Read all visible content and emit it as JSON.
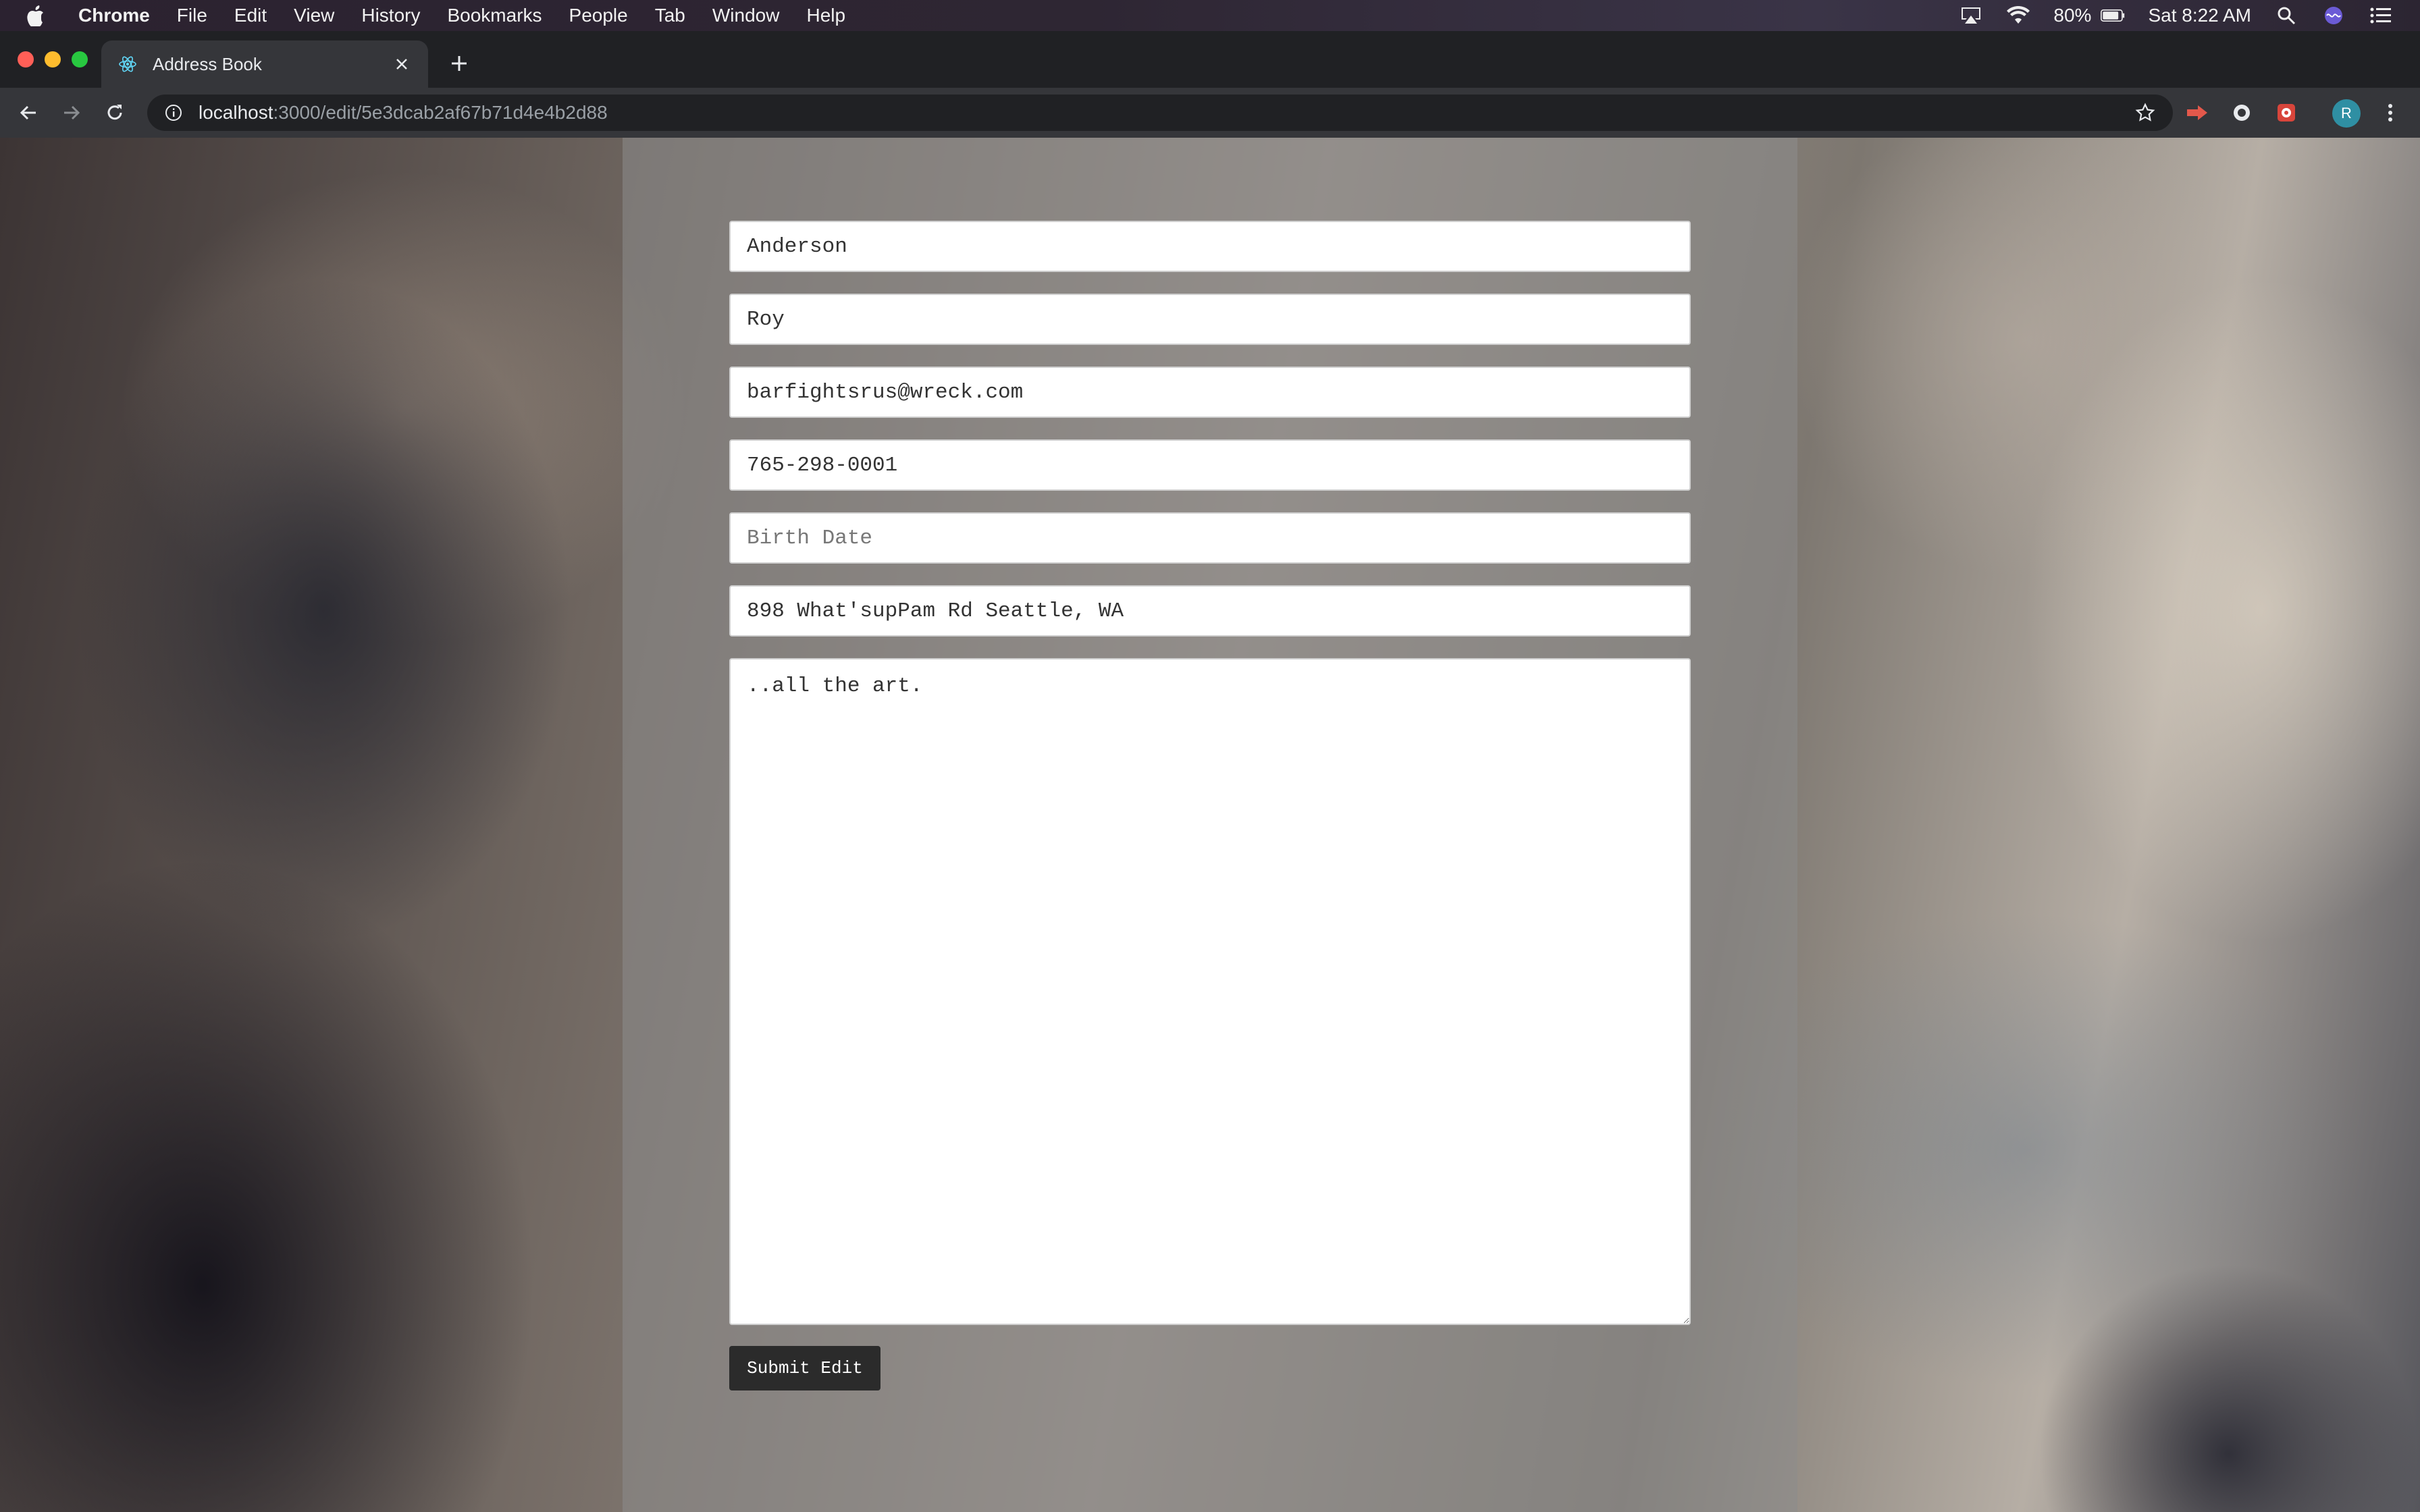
{
  "menubar": {
    "app_name": "Chrome",
    "items": [
      "File",
      "Edit",
      "View",
      "History",
      "Bookmarks",
      "People",
      "Tab",
      "Window",
      "Help"
    ],
    "battery": "80%",
    "clock": "Sat 8:22 AM"
  },
  "browser": {
    "tab_title": "Address Book",
    "url_host": "localhost",
    "url_path": ":3000/edit/5e3dcab2af67b71d4e4b2d88",
    "profile_initial": "R"
  },
  "form": {
    "last_name": "Anderson",
    "first_name": "Roy",
    "email": "barfightsrus@wreck.com",
    "phone": "765-298-0001",
    "birth_date_placeholder": "Birth Date",
    "address": "898 What'supPam Rd Seattle, WA",
    "notes": "..all the art.",
    "submit_label": "Submit Edit"
  },
  "colors": {
    "tab_strip": "#202124",
    "toolbar": "#35363a",
    "button": "#2b2b2b"
  }
}
